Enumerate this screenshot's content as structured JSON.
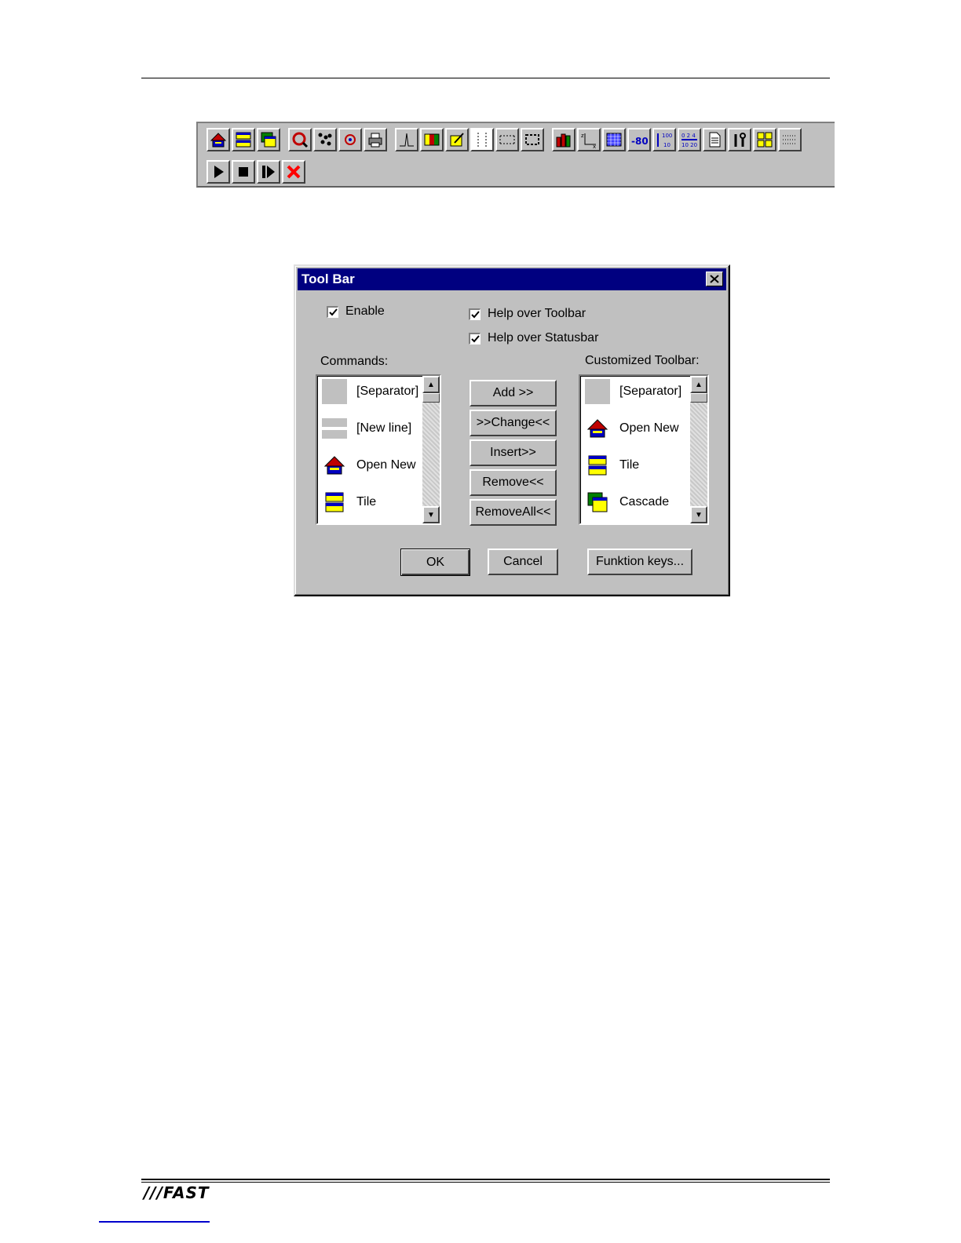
{
  "toolbar": {
    "row1_icons": [
      "open-new-icon",
      "tile-icon",
      "cascade-icon",
      "zoom-icon",
      "scatter-icon",
      "zoom-point-icon",
      "print-icon",
      "peak-icon",
      "color-bars-icon",
      "edit-chart-icon",
      "dotted-vline-icon",
      "dotted-grid-icon",
      "dotted-rect-icon",
      "bar-chart-icon",
      "axes-icon",
      "grid-fill-icon",
      "scale-80-icon",
      "scale-100-icon",
      "ticks-icon",
      "document-icon",
      "tools-icon",
      "layout-grid-icon",
      "dotted-lines-icon"
    ],
    "row2_icons": [
      "play-icon",
      "stop-icon",
      "step-icon",
      "cancel-icon"
    ]
  },
  "dialog": {
    "title": "Tool Bar",
    "enable_label": "Enable",
    "help_toolbar_label": "Help over Toolbar",
    "help_statusbar_label": "Help over Statusbar",
    "commands_label": "Commands:",
    "customized_label": "Customized Toolbar:",
    "commands": [
      {
        "label": "[Separator]",
        "icon": "separator-icon"
      },
      {
        "label": "[New line]",
        "icon": "new-line-icon"
      },
      {
        "label": "Open New",
        "icon": "open-new-icon"
      },
      {
        "label": "Tile",
        "icon": "tile-icon"
      }
    ],
    "customized": [
      {
        "label": "[Separator]",
        "icon": "separator-icon"
      },
      {
        "label": "Open New",
        "icon": "open-new-icon"
      },
      {
        "label": "Tile",
        "icon": "tile-icon"
      },
      {
        "label": "Cascade",
        "icon": "cascade-icon"
      }
    ],
    "buttons": {
      "add": "Add >>",
      "change": ">>Change<<",
      "insert": "Insert>>",
      "remove": "Remove<<",
      "remove_all": "RemoveAll<<",
      "ok": "OK",
      "cancel": "Cancel",
      "funktion_keys": "Funktion keys..."
    }
  },
  "footer": {
    "logo": "///FAST"
  },
  "colors": {
    "titlebar": "#000080",
    "face": "#c0c0c0",
    "cancel_x": "#ff0000"
  }
}
